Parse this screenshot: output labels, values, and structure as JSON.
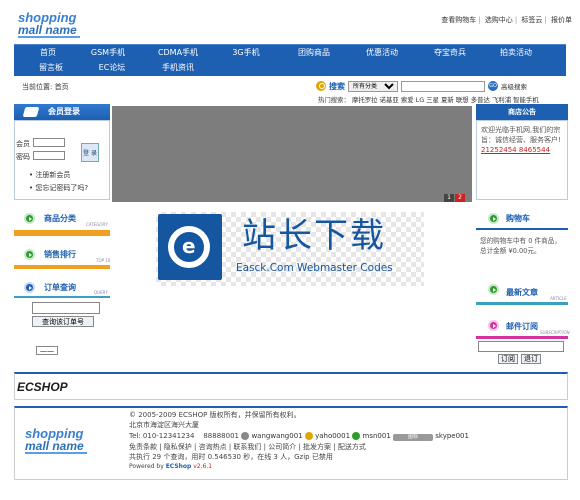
{
  "header": {
    "logo_line1": "shopping",
    "logo_line2": "mall name",
    "top_links": [
      "查看购物车",
      "选购中心",
      "标签云",
      "报价单"
    ]
  },
  "nav": {
    "row1": [
      "首页",
      "GSM手机",
      "CDMA手机",
      "3G手机",
      "团购商品",
      "优惠活动",
      "夺宝奇兵",
      "拍卖活动"
    ],
    "row2": [
      "留言板",
      "EC论坛",
      "手机资讯"
    ]
  },
  "breadcrumb": "当前位置: 首页",
  "search": {
    "label": "搜索",
    "category": "所有分类",
    "adv_label": "高级搜索",
    "hot_prefix": "热门搜索：",
    "hot_terms": [
      "摩托罗拉",
      "诺基亚",
      "索爱",
      "LG",
      "三星",
      "夏新",
      "联想",
      "多普达",
      "飞利浦",
      "智能手机"
    ]
  },
  "login": {
    "title": "会员登录",
    "user_label": "会员",
    "pass_label": "密码",
    "submit": "登 录",
    "register": "注册新会员",
    "forgot": "您忘记密码了吗?"
  },
  "banner": {
    "pages": [
      "1",
      "2"
    ]
  },
  "notice": {
    "title": "商店公告",
    "text": "欢迎光临手机网,我们的宗旨：诚信经营、服务客户!",
    "phone": "21252454 8465544"
  },
  "left": {
    "category_title": "商品分类",
    "category_tag": "CATEGORY",
    "top_title": "销售排行",
    "top_tag": "TOP 10",
    "order_title": "订单查询",
    "order_tag": "QUERY",
    "order_btn": "查询该订单号",
    "vote_btn": "——"
  },
  "watermark": {
    "cn": "站长下载",
    "en": "Easck.Com Webmaster Codes"
  },
  "right": {
    "cart_title": "购物车",
    "cart_text": "您的购物车中有 0 件商品，总计金额 ¥0.00元。",
    "news_title": "最新文章",
    "news_tag": "ARTICLE",
    "sub_title": "邮件订阅",
    "sub_tag": "SUBSCRIPTION",
    "sub_btn": "订阅",
    "unsub_btn": "退订"
  },
  "brand": "ECSHOP",
  "footer": {
    "logo_line1": "shopping",
    "logo_line2": "mall name",
    "copyright": "© 2005-2009 ECSHOP 版权所有，并保留所有权利。",
    "address": "北京市海淀区海兴大厦",
    "tel_prefix": "Tel: 010-12341234",
    "phone2": "88888001",
    "im1": "wangwang001",
    "im2": "yaho0001",
    "im3": "msn001",
    "im4_btn": "图标",
    "im4": "skype001",
    "links": "免责条款 | 隐私保护 | 咨询热点 | 联系我们 | 公司简介 | 批发方案 | 配送方式",
    "stats": "共执行 29 个查询，用时 0.546530 秒，在线 3 人，Gzip 已禁用",
    "powered": "Powered by",
    "powered_brand": "ECShop",
    "version": "v2.6.1"
  },
  "colors": {
    "primary": "#1d5fb1",
    "accent_red": "#cc2222",
    "orange": "#f0a020",
    "green": "#2a9d2a"
  }
}
